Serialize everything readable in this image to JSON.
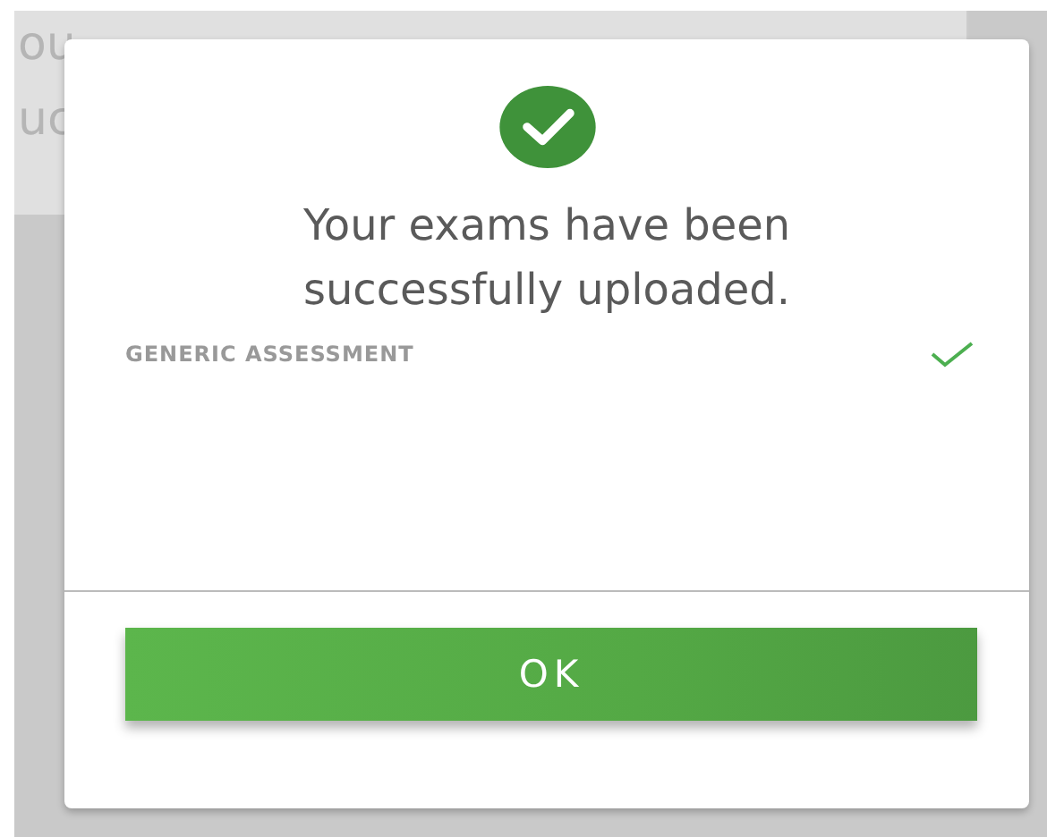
{
  "background": {
    "lines": [
      "ou",
      "uc"
    ]
  },
  "dialog": {
    "title": "Your exams have been successfully uploaded.",
    "items": [
      {
        "label": "GENERIC ASSESSMENT",
        "uploaded": true
      }
    ],
    "button": "OK"
  }
}
